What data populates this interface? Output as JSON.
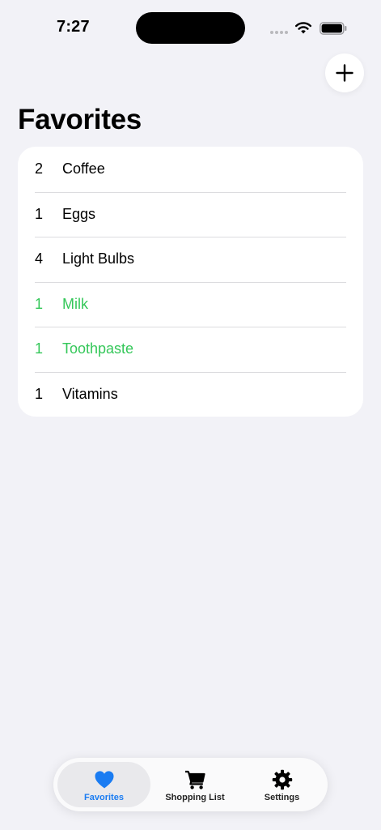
{
  "status_bar": {
    "time": "7:27"
  },
  "header": {
    "title": "Favorites",
    "add_icon": "plus-icon"
  },
  "favorites": [
    {
      "qty": "2",
      "name": "Coffee",
      "highlighted": false
    },
    {
      "qty": "1",
      "name": "Eggs",
      "highlighted": false
    },
    {
      "qty": "4",
      "name": "Light Bulbs",
      "highlighted": false
    },
    {
      "qty": "1",
      "name": "Milk",
      "highlighted": true
    },
    {
      "qty": "1",
      "name": "Toothpaste",
      "highlighted": true
    },
    {
      "qty": "1",
      "name": "Vitamins",
      "highlighted": false
    }
  ],
  "tab_bar": {
    "tabs": [
      {
        "label": "Favorites",
        "icon": "heart-icon",
        "selected": true
      },
      {
        "label": "Shopping List",
        "icon": "cart-icon",
        "selected": false
      },
      {
        "label": "Settings",
        "icon": "gear-icon",
        "selected": false
      }
    ]
  },
  "colors": {
    "background": "#f2f2f7",
    "highlight": "#34c759",
    "accent": "#1a7cf2"
  }
}
